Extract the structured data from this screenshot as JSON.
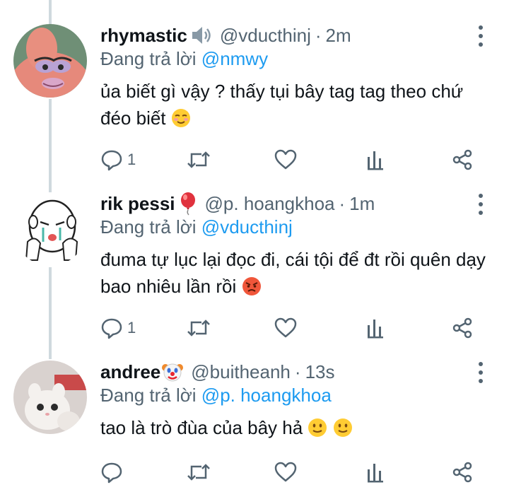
{
  "tweets": [
    {
      "name": "rhymastic",
      "badge_icon": "speaker-icon",
      "handle": "@vducthinj",
      "separator": "·",
      "time": "2m",
      "replying_prefix": "Đang trả lời",
      "replying_to": "@nmwy",
      "text": "ủa biết gì vậy ? thấy tụi bây tag tag theo chứ đéo biết",
      "text_emoji": "relieved-face-emoji",
      "reply_count": "1",
      "retweet_count": "",
      "like_count": ""
    },
    {
      "name": "rik pessi",
      "badge_icon": "red-balloon-icon",
      "handle": "@p. hoangkhoa",
      "separator": "·",
      "time": "1m",
      "replying_prefix": "Đang trả lời",
      "replying_to": "@vducthinj",
      "text": "đuma tự lục lại đọc đi, cái tội để đt rồi quên dạy bao nhiêu lần rồi",
      "text_emoji": "angry-face-emoji",
      "reply_count": "1",
      "retweet_count": "",
      "like_count": ""
    },
    {
      "name": "andree",
      "badge_icon": "clown-face-icon",
      "handle": "@buitheanh",
      "separator": "·",
      "time": "13s",
      "replying_prefix": "Đang trả lời",
      "replying_to": "@p. hoangkhoa",
      "text": "tao là trò đùa của bây hả",
      "text_emoji": "slightly-smiling-face-emoji x2",
      "reply_count": "",
      "retweet_count": "",
      "like_count": ""
    }
  ],
  "colors": {
    "mention": "#1d9bf0",
    "secondary_text": "#536471",
    "primary_text": "#0f1419",
    "thread_line": "#cfd9de"
  }
}
